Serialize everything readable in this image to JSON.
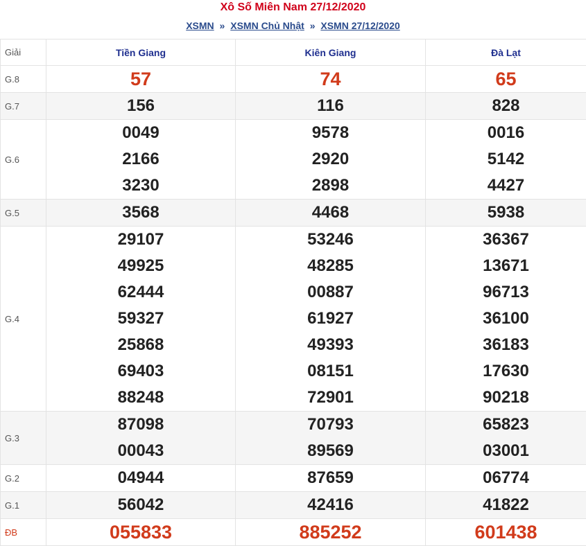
{
  "header": {
    "title": "Xô Số Miên Nam 27/12/2020",
    "breadcrumbs": [
      "XSMN",
      "XSMN Chủ Nhật",
      "XSMN 27/12/2020"
    ],
    "separator": "»"
  },
  "table": {
    "label_header": "Giải",
    "provinces": [
      "Tiền Giang",
      "Kiên Giang",
      "Đà Lạt"
    ],
    "rows": [
      {
        "label": "G.8",
        "highlight": true,
        "values": [
          [
            "57"
          ],
          [
            "74"
          ],
          [
            "65"
          ]
        ]
      },
      {
        "label": "G.7",
        "values": [
          [
            "156"
          ],
          [
            "116"
          ],
          [
            "828"
          ]
        ]
      },
      {
        "label": "G.6",
        "values": [
          [
            "0049",
            "2166",
            "3230"
          ],
          [
            "9578",
            "2920",
            "2898"
          ],
          [
            "0016",
            "5142",
            "4427"
          ]
        ]
      },
      {
        "label": "G.5",
        "values": [
          [
            "3568"
          ],
          [
            "4468"
          ],
          [
            "5938"
          ]
        ]
      },
      {
        "label": "G.4",
        "values": [
          [
            "29107",
            "49925",
            "62444",
            "59327",
            "25868",
            "69403",
            "88248"
          ],
          [
            "53246",
            "48285",
            "00887",
            "61927",
            "49393",
            "08151",
            "72901"
          ],
          [
            "36367",
            "13671",
            "96713",
            "36100",
            "36183",
            "17630",
            "90218"
          ]
        ]
      },
      {
        "label": "G.3",
        "values": [
          [
            "87098",
            "00043"
          ],
          [
            "70793",
            "89569"
          ],
          [
            "65823",
            "03001"
          ]
        ]
      },
      {
        "label": "G.2",
        "values": [
          [
            "04944"
          ],
          [
            "87659"
          ],
          [
            "06774"
          ]
        ]
      },
      {
        "label": "G.1",
        "values": [
          [
            "56042"
          ],
          [
            "42416"
          ],
          [
            "41822"
          ]
        ]
      },
      {
        "label": "ĐB",
        "highlight": true,
        "values": [
          [
            "055833"
          ],
          [
            "885252"
          ],
          [
            "601438"
          ]
        ]
      }
    ]
  },
  "colors": {
    "title": "#d0021b",
    "link": "#2a4b8c",
    "province": "#1f2f8f",
    "highlight": "#d13b1b"
  }
}
